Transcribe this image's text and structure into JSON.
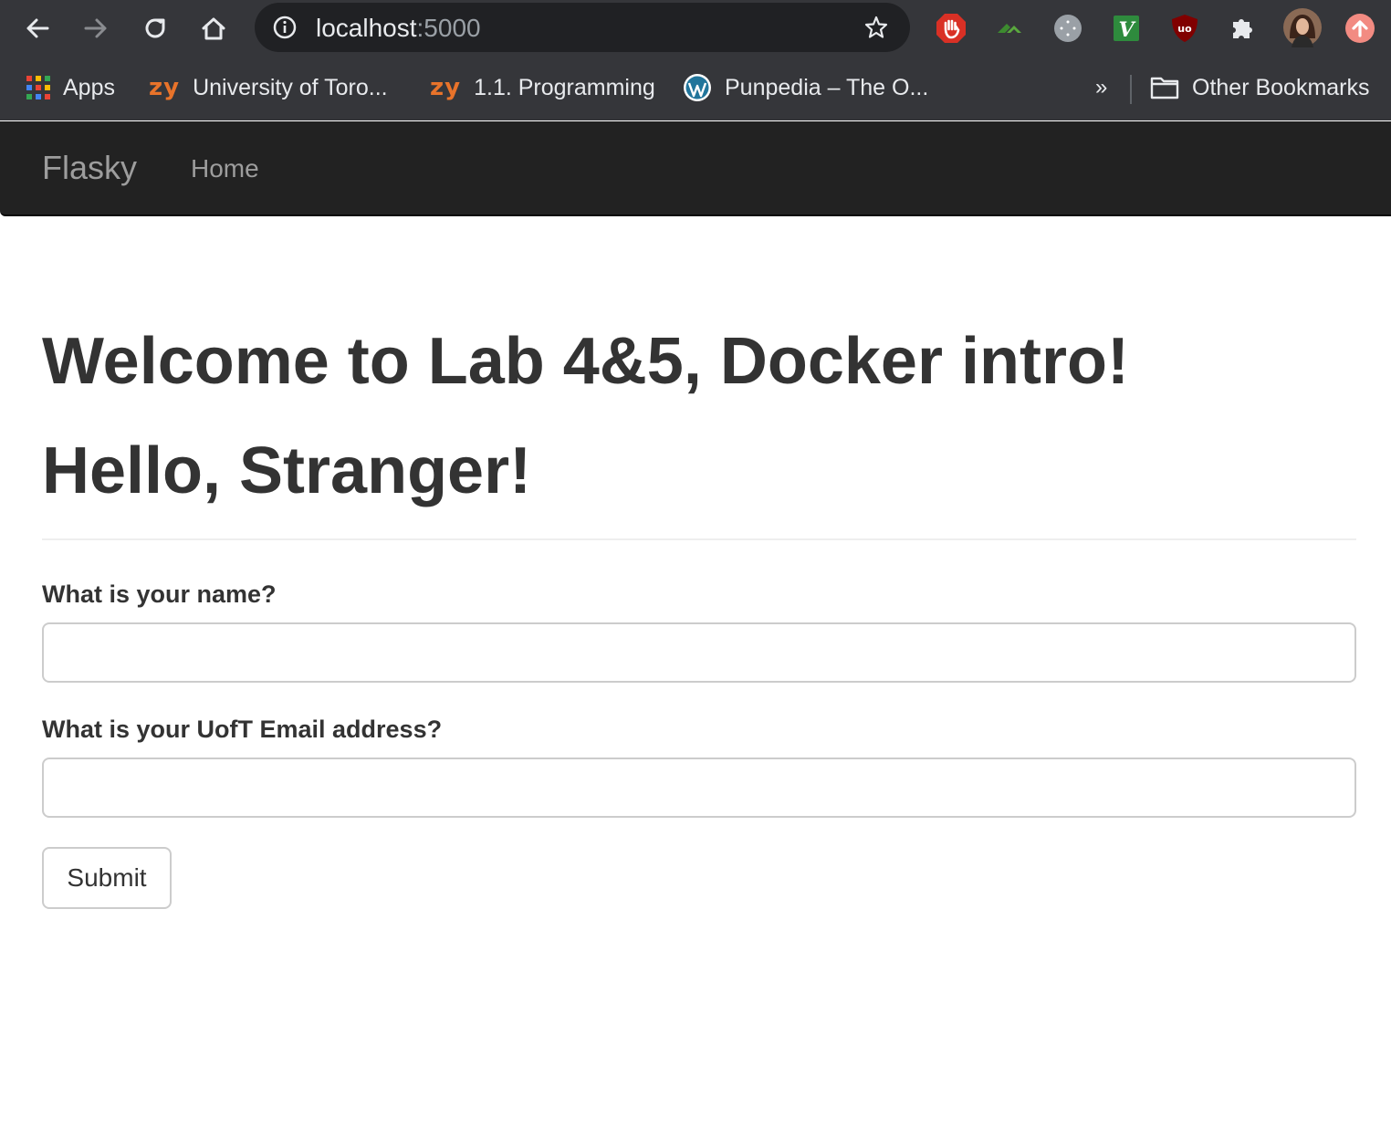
{
  "browser": {
    "url_host": "localhost",
    "url_port": ":5000",
    "colors": {
      "chrome_bg": "#35363a",
      "omnibox_bg": "#202124"
    },
    "extensions": [
      "stop-hand-extension-icon",
      "green-chevron-extension-icon",
      "gray-circle-extension-icon",
      "v-extension-icon",
      "ublock-origin-icon",
      "puzzle-extensions-icon",
      "profile-avatar",
      "update-icon"
    ],
    "bookmarks": [
      {
        "label": "Apps",
        "icon": "apps-grid-icon"
      },
      {
        "label": "University of Toro...",
        "icon": "zy",
        "icon_text": "zy"
      },
      {
        "label": "1.1. Programming",
        "icon": "zy",
        "icon_text": "zy"
      },
      {
        "label": "Punpedia – The O...",
        "icon": "wordpress-icon"
      }
    ],
    "overflow_label": "»",
    "other_bookmarks": "Other Bookmarks"
  },
  "navbar": {
    "brand": "Flasky",
    "links": [
      {
        "label": "Home"
      }
    ],
    "colors": {
      "bg": "#222222",
      "link": "#9d9d9d"
    }
  },
  "page": {
    "heading": "Welcome to Lab 4&5, Docker intro!",
    "greeting": "Hello, Stranger!"
  },
  "form": {
    "name_label": "What is your name?",
    "name_value": "",
    "email_label": "What is your UofT Email address?",
    "email_value": "",
    "submit_label": "Submit"
  }
}
